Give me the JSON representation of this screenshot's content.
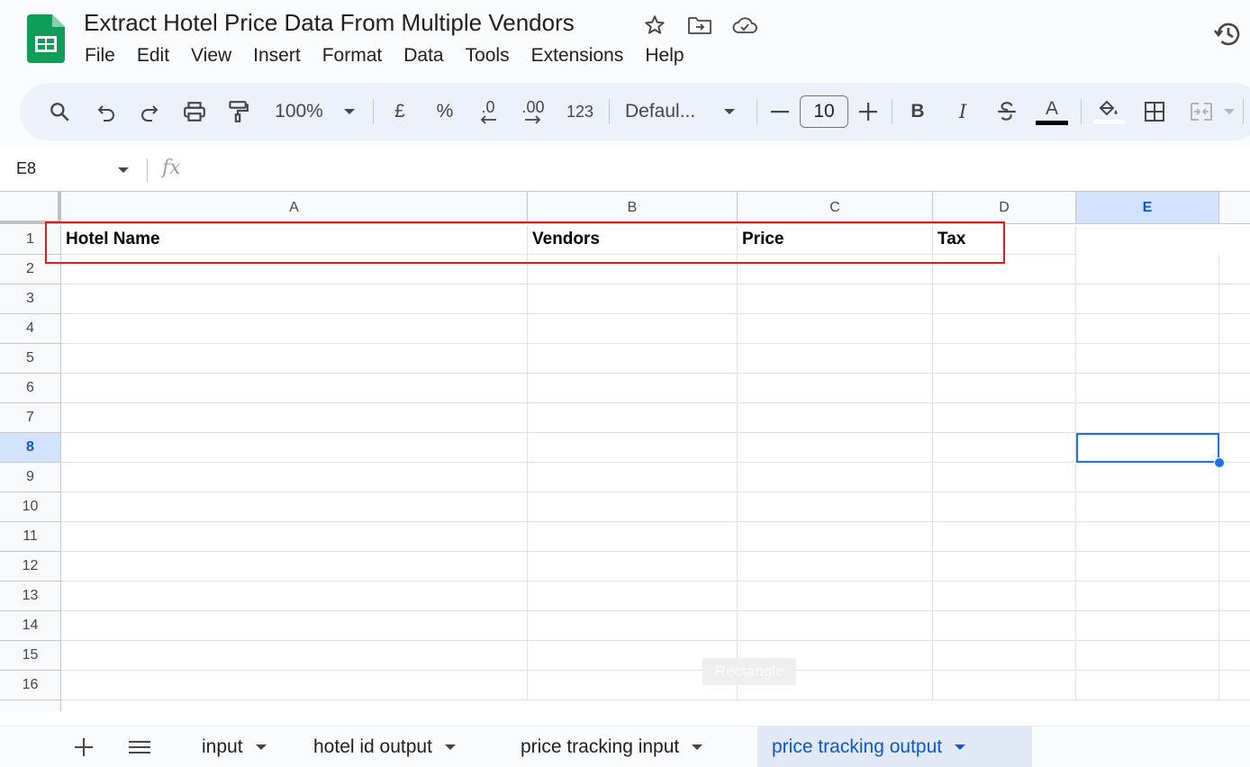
{
  "document": {
    "title": "Extract Hotel Price Data From Multiple Vendors"
  },
  "menu": [
    "File",
    "Edit",
    "View",
    "Insert",
    "Format",
    "Data",
    "Tools",
    "Extensions",
    "Help"
  ],
  "toolbar": {
    "zoom": "100%",
    "currency": "£",
    "percent": "%",
    "decrease_decimal": ".0",
    "increase_decimal": ".00",
    "number_format": "123",
    "font": "Defaul...",
    "font_size": "10",
    "bold": "B",
    "italic": "I",
    "text_color_letter": "A"
  },
  "formula_bar": {
    "name_box": "E8",
    "fx": "fx",
    "value": ""
  },
  "columns": [
    "A",
    "B",
    "C",
    "D",
    "E"
  ],
  "rows": [
    "1",
    "2",
    "3",
    "4",
    "5",
    "6",
    "7",
    "8",
    "9",
    "10",
    "11",
    "12",
    "13",
    "14",
    "15",
    "16"
  ],
  "active_cell": {
    "column": "E",
    "row": "8"
  },
  "header_row": [
    "Hotel Name",
    "Vendors",
    "Price",
    "Tax"
  ],
  "watermark": "Rectangle",
  "sheets": [
    {
      "name": "input",
      "active": false
    },
    {
      "name": "hotel id output",
      "active": false
    },
    {
      "name": "price tracking input",
      "active": false
    },
    {
      "name": "price tracking output",
      "active": true
    }
  ],
  "colors": {
    "accent": "#0b57d0",
    "selection": "#1a73e8",
    "annotation": "#e01b1b",
    "sheets_green": "#0f9d58"
  }
}
